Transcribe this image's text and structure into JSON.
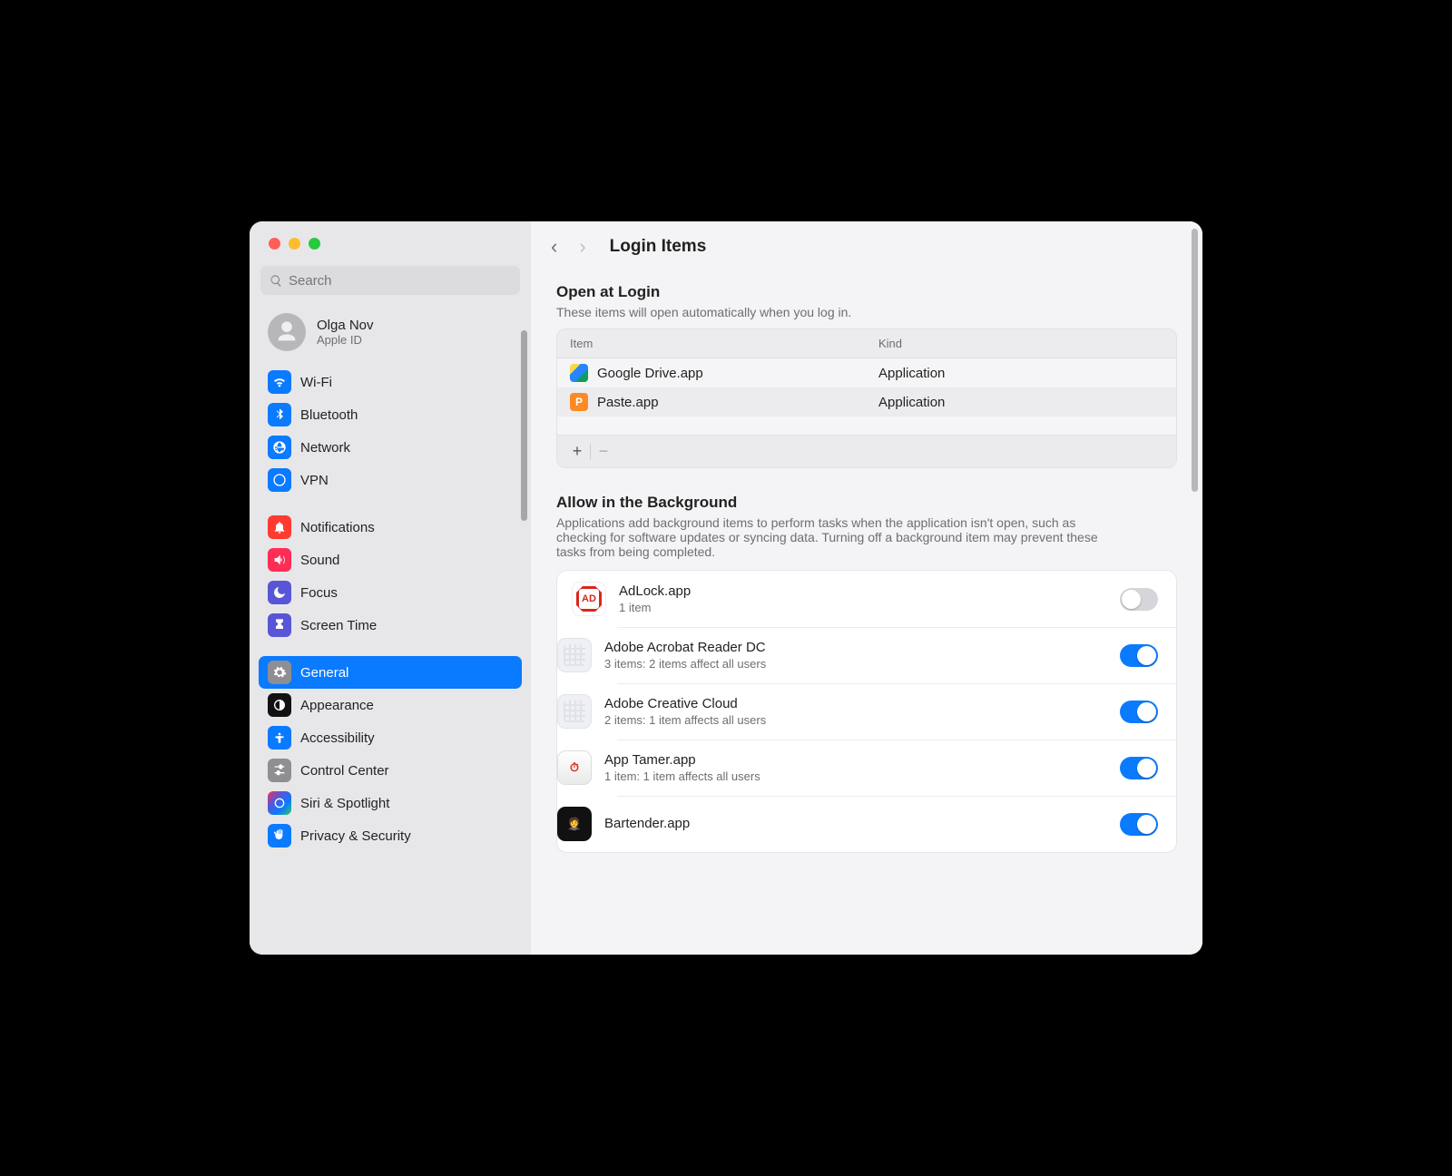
{
  "window": {
    "title": "Login Items"
  },
  "search": {
    "placeholder": "Search"
  },
  "account": {
    "name": "Olga Nov",
    "sub": "Apple ID"
  },
  "sidebar": {
    "groups": [
      {
        "items": [
          {
            "label": "Wi-Fi",
            "color": "#0a7aff"
          },
          {
            "label": "Bluetooth",
            "color": "#0a7aff"
          },
          {
            "label": "Network",
            "color": "#0a7aff"
          },
          {
            "label": "VPN",
            "color": "#0a7aff"
          }
        ]
      },
      {
        "items": [
          {
            "label": "Notifications",
            "color": "#ff3b30"
          },
          {
            "label": "Sound",
            "color": "#ff2d55"
          },
          {
            "label": "Focus",
            "color": "#5856d6"
          },
          {
            "label": "Screen Time",
            "color": "#5856d6"
          }
        ]
      },
      {
        "items": [
          {
            "label": "General",
            "color": "#8e8e93",
            "selected": true
          },
          {
            "label": "Appearance",
            "color": "#111"
          },
          {
            "label": "Accessibility",
            "color": "#0a7aff"
          },
          {
            "label": "Control Center",
            "color": "#8e8e93"
          },
          {
            "label": "Siri & Spotlight",
            "color": "grad"
          },
          {
            "label": "Privacy & Security",
            "color": "#0a7aff"
          }
        ]
      }
    ]
  },
  "open_login": {
    "heading": "Open at Login",
    "sub": "These items will open automatically when you log in.",
    "cols": {
      "item": "Item",
      "kind": "Kind"
    },
    "rows": [
      {
        "name": "Google Drive.app",
        "kind": "Application",
        "icon": "gd"
      },
      {
        "name": "Paste.app",
        "kind": "Application",
        "icon": "pa"
      }
    ],
    "add": "+",
    "remove": "−"
  },
  "background": {
    "heading": "Allow in the Background",
    "sub": "Applications add background items to perform tasks when the application isn't open, such as checking for software updates or syncing data. Turning off a background item may prevent these tasks from being completed.",
    "items": [
      {
        "name": "AdLock.app",
        "sub": "1 item",
        "on": false,
        "icon": "adlock"
      },
      {
        "name": "Adobe Acrobat Reader DC",
        "sub": "3 items: 2 items affect all users",
        "on": true,
        "icon": "placeholder"
      },
      {
        "name": "Adobe Creative Cloud",
        "sub": "2 items: 1 item affects all users",
        "on": true,
        "icon": "placeholder"
      },
      {
        "name": "App Tamer.app",
        "sub": "1 item: 1 item affects all users",
        "on": true,
        "icon": "apptamer"
      },
      {
        "name": "Bartender.app",
        "sub": "",
        "on": true,
        "icon": "bartender"
      }
    ]
  }
}
